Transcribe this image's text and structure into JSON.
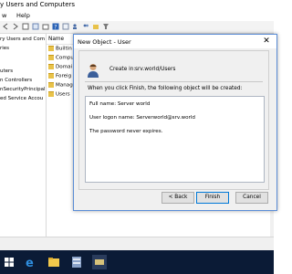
{
  "window": {
    "title": "y Users and Computers"
  },
  "menu": {
    "items": [
      "w",
      "Help"
    ]
  },
  "tree": {
    "items": [
      "ry Users and Com",
      "ries",
      "uters",
      "n Controllers",
      "nSecurityPrincipal",
      "ed Service Accou"
    ]
  },
  "list": {
    "column_name": "Name",
    "items": [
      "Builtin",
      "Compu",
      "Domai",
      "Foreig",
      "Manag",
      "Users"
    ]
  },
  "dialog": {
    "title": "New Object - User",
    "close_glyph": "✕",
    "create_in_label": "Create in:",
    "create_in_value": "srv.world/Users",
    "intro": "When you click Finish, the following object will be created:",
    "summary_lines": [
      "Full name: Server world",
      "User logon name: Serverworld@srv.world",
      "The password never expires."
    ],
    "buttons": {
      "back": "< Back",
      "finish": "Finish",
      "cancel": "Cancel"
    }
  },
  "colors": {
    "accent": "#0078d7",
    "taskbar": "#0b1b36",
    "dialog_border": "#5b8dd6"
  },
  "icons": [
    "user-icon",
    "folder-icon",
    "edge-icon",
    "file-explorer-icon",
    "server-manager-icon",
    "ad-users-computers-icon"
  ]
}
